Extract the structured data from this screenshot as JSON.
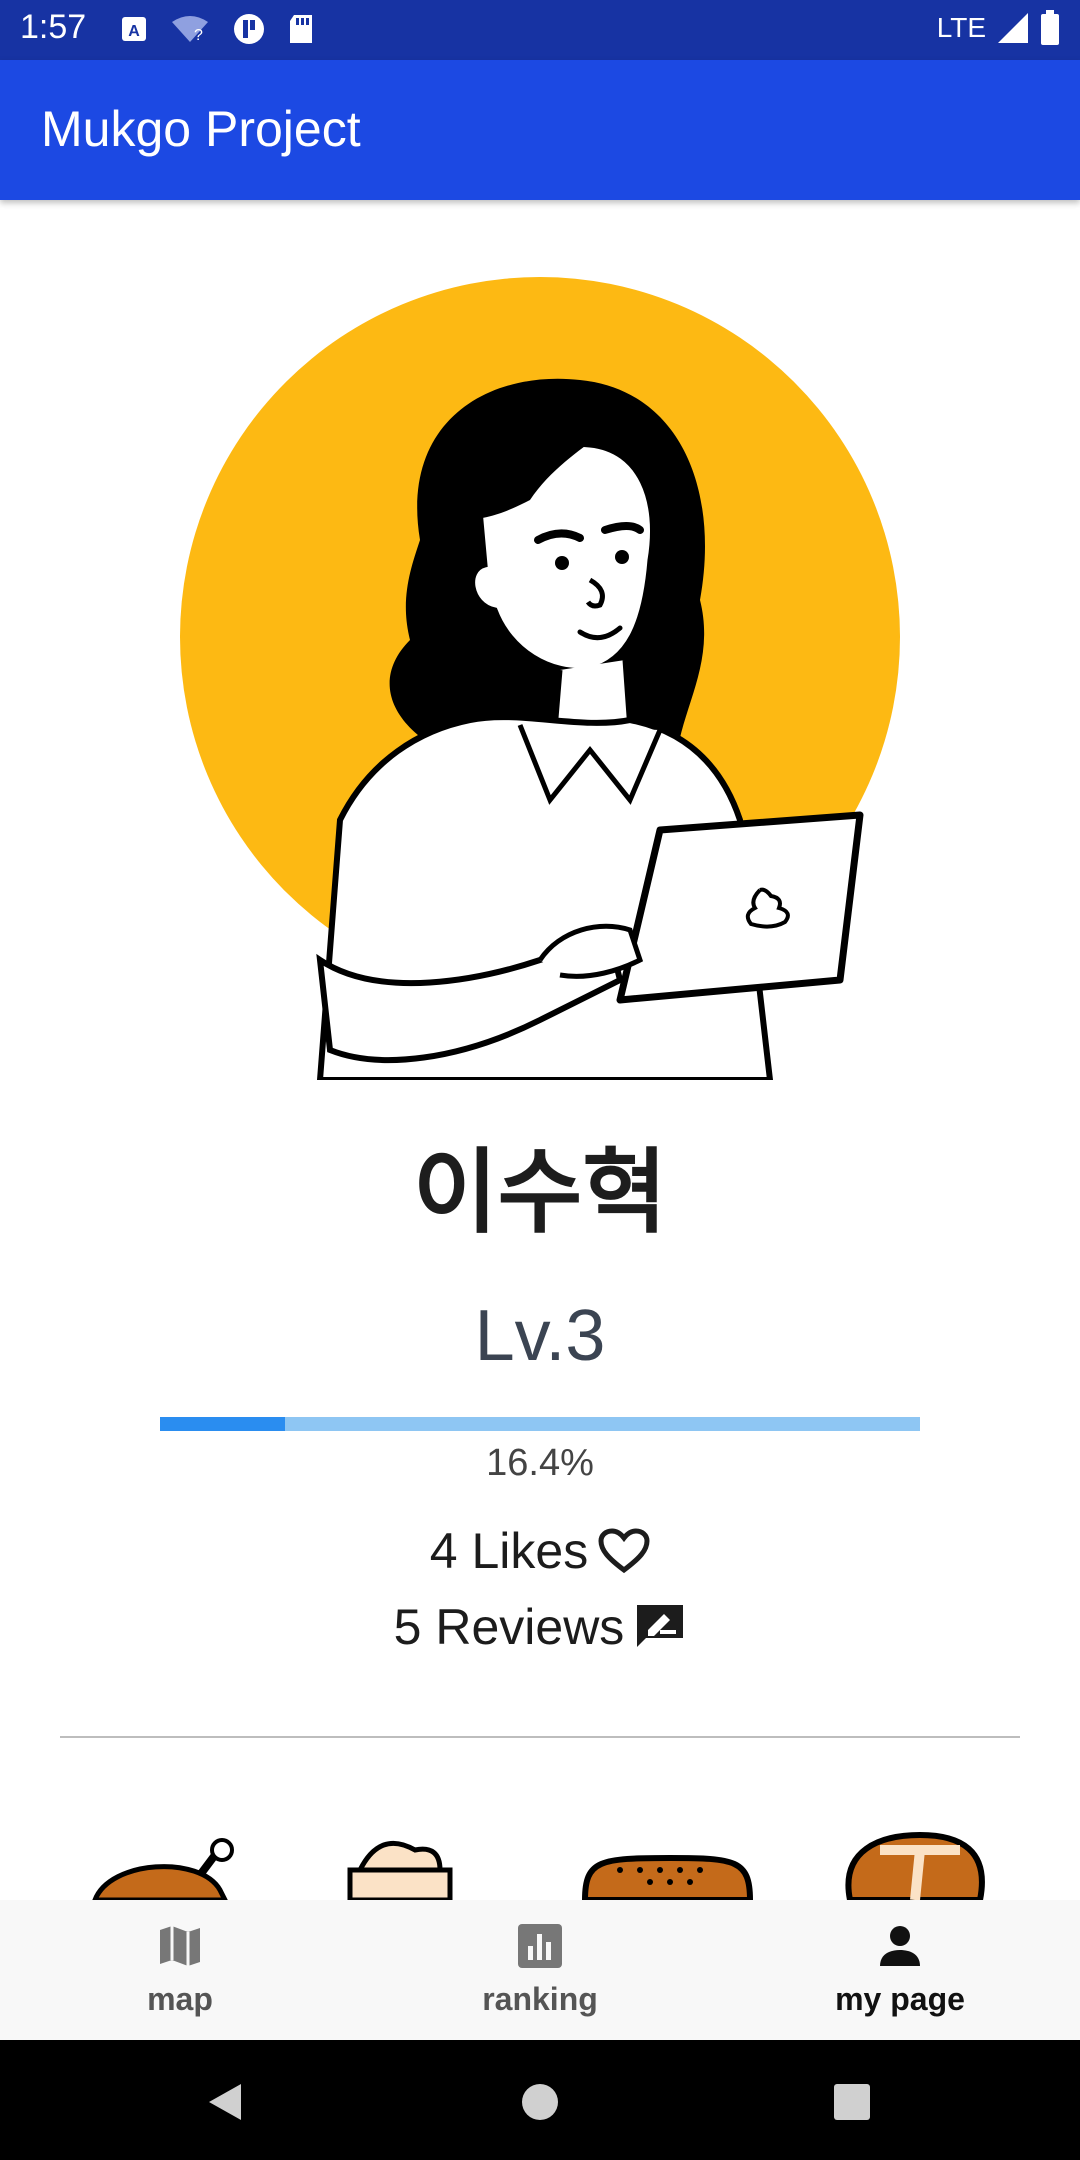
{
  "status_bar": {
    "time": "1:57",
    "network": "LTE"
  },
  "app_bar": {
    "title": "Mukgo Project"
  },
  "profile": {
    "name": "이수혁",
    "level": "Lv.3",
    "progress_fraction": 0.164,
    "progress_text": "16.4%",
    "likes": "4 Likes",
    "reviews": "5 Reviews"
  },
  "bottom_nav": {
    "items": [
      {
        "label": "map",
        "icon": "map-icon"
      },
      {
        "label": "ranking",
        "icon": "ranking-icon"
      },
      {
        "label": "my page",
        "icon": "person-icon"
      }
    ],
    "selected": "my page"
  },
  "colors": {
    "status_bar": "#1733a3",
    "app_bar": "#1c49e3",
    "avatar_circle": "#fdb913",
    "progress_fill": "#2a8df0",
    "progress_track": "#8ec6f3"
  }
}
